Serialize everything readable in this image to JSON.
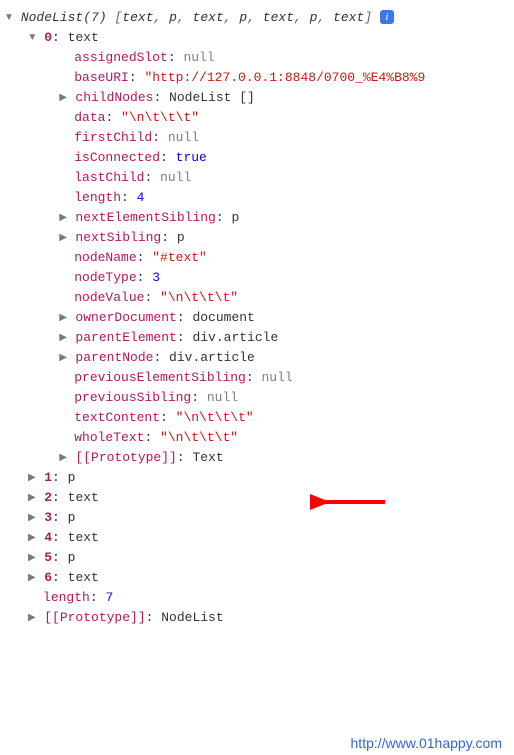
{
  "header": {
    "label": "NodeList",
    "count": "7",
    "items": [
      "text",
      "p",
      "text",
      "p",
      "text",
      "p",
      "text"
    ],
    "info_glyph": "i"
  },
  "entry0": {
    "index": "0",
    "type": "text",
    "rows": [
      {
        "tri": "",
        "key": "assignedSlot",
        "sep": ": ",
        "valClass": "nul",
        "val": "null"
      },
      {
        "tri": "",
        "key": "baseURI",
        "sep": ": ",
        "valClass": "str",
        "val": "\"http://127.0.0.1:8848/0700_%E4%B8%9"
      },
      {
        "tri": "▶",
        "key": "childNodes",
        "sep": ": ",
        "valClass": "type",
        "val": "NodeList []"
      },
      {
        "tri": "",
        "key": "data",
        "sep": ": ",
        "valClass": "str",
        "val": "\"\\n\\t\\t\\t\""
      },
      {
        "tri": "",
        "key": "firstChild",
        "sep": ": ",
        "valClass": "nul",
        "val": "null"
      },
      {
        "tri": "",
        "key": "isConnected",
        "sep": ": ",
        "valClass": "kw",
        "val": "true"
      },
      {
        "tri": "",
        "key": "lastChild",
        "sep": ": ",
        "valClass": "nul",
        "val": "null"
      },
      {
        "tri": "",
        "key": "length",
        "sep": ": ",
        "valClass": "num",
        "val": "4"
      },
      {
        "tri": "▶",
        "key": "nextElementSibling",
        "sep": ": ",
        "valClass": "type",
        "val": "p"
      },
      {
        "tri": "▶",
        "key": "nextSibling",
        "sep": ": ",
        "valClass": "type",
        "val": "p"
      },
      {
        "tri": "",
        "key": "nodeName",
        "sep": ": ",
        "valClass": "str",
        "val": "\"#text\""
      },
      {
        "tri": "",
        "key": "nodeType",
        "sep": ": ",
        "valClass": "num",
        "val": "3"
      },
      {
        "tri": "",
        "key": "nodeValue",
        "sep": ": ",
        "valClass": "str",
        "val": "\"\\n\\t\\t\\t\""
      },
      {
        "tri": "▶",
        "key": "ownerDocument",
        "sep": ": ",
        "valClass": "type",
        "val": "document"
      },
      {
        "tri": "▶",
        "key": "parentElement",
        "sep": ": ",
        "valClass": "type",
        "val": "div.article"
      },
      {
        "tri": "▶",
        "key": "parentNode",
        "sep": ": ",
        "valClass": "type",
        "val": "div.article"
      },
      {
        "tri": "",
        "key": "previousElementSibling",
        "sep": ": ",
        "valClass": "nul",
        "val": "null"
      },
      {
        "tri": "",
        "key": "previousSibling",
        "sep": ": ",
        "valClass": "nul",
        "val": "null"
      },
      {
        "tri": "",
        "key": "textContent",
        "sep": ": ",
        "valClass": "str",
        "val": "\"\\n\\t\\t\\t\""
      },
      {
        "tri": "",
        "key": "wholeText",
        "sep": ": ",
        "valClass": "str",
        "val": "\"\\n\\t\\t\\t\""
      },
      {
        "tri": "▶",
        "key": "[[Prototype]]",
        "sep": ": ",
        "valClass": "type",
        "val": "Text"
      }
    ]
  },
  "siblings": [
    {
      "index": "1",
      "type": "p"
    },
    {
      "index": "2",
      "type": "text"
    },
    {
      "index": "3",
      "type": "p"
    },
    {
      "index": "4",
      "type": "text"
    },
    {
      "index": "5",
      "type": "p"
    },
    {
      "index": "6",
      "type": "text"
    }
  ],
  "length_row": {
    "key": "length",
    "val": "7"
  },
  "proto_row": {
    "key": "[[Prototype]]",
    "val": "NodeList"
  },
  "watermark": "http://www.01happy.com"
}
